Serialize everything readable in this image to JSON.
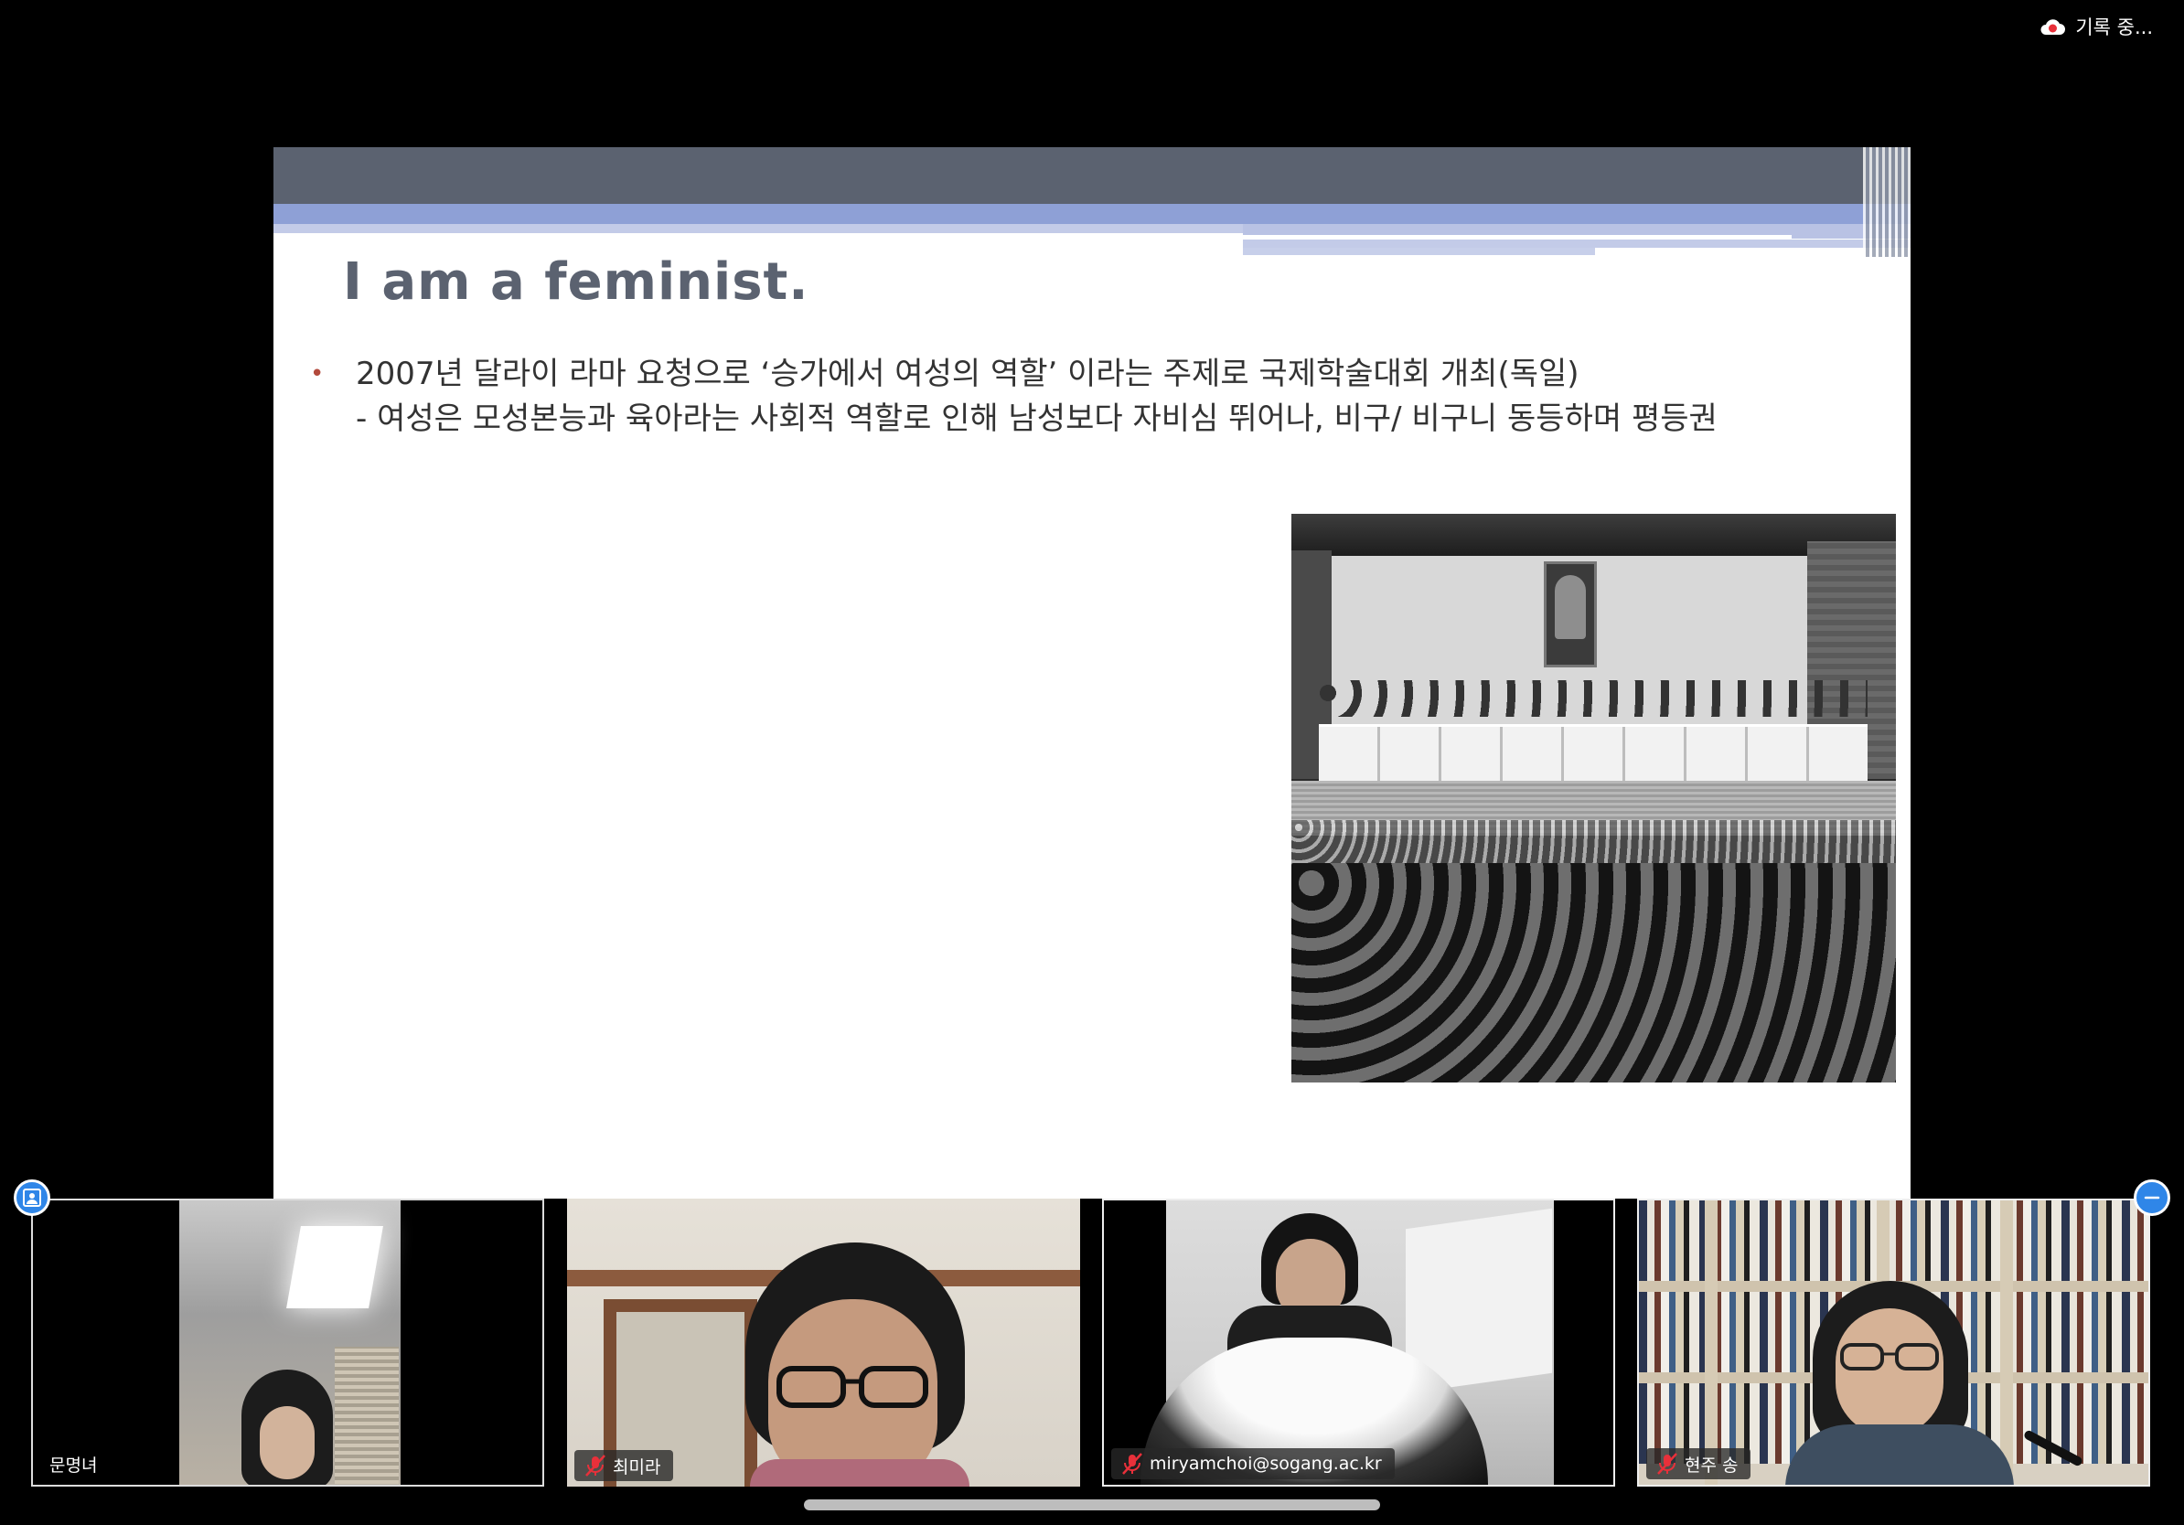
{
  "status_bar": {
    "recording_label": "기록 중...",
    "recording_icon": "cloud-record-icon",
    "recording_color": "#e8303a"
  },
  "slide": {
    "title": "I am a feminist.",
    "bullet_marker": "•",
    "bullet_line1": "2007년 달라이 라마 요청으로 ‘승가에서 여성의 역할’ 이라는 주제로 국제학술대회 개최(독일)",
    "bullet_line2": "- 여성은 모성본능과 육아라는 사회적 역할로 인해 남성보다 자비심 뛰어나, 비구/ 비구니 동등하며 평등권"
  },
  "participants": [
    {
      "name": "문명녀",
      "muted": false
    },
    {
      "name": "최미라",
      "muted": true
    },
    {
      "name": "miryamchoi@sogang.ac.kr",
      "muted": true
    },
    {
      "name": "현주 송",
      "muted": true
    }
  ],
  "controls": {
    "left_button_icon": "participant-view-icon",
    "right_button_icon": "minimize-icon",
    "accent_color": "#2f86e8"
  }
}
